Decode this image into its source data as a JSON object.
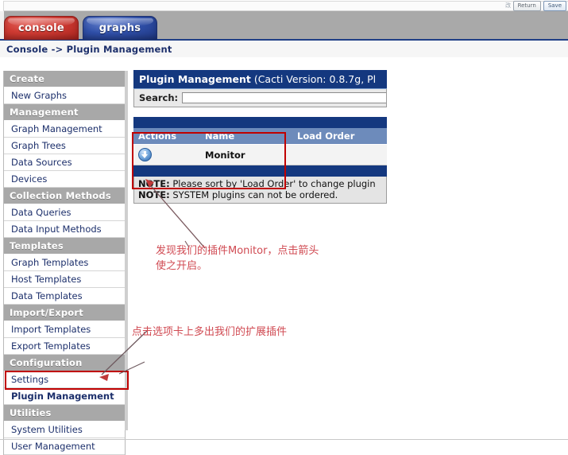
{
  "toolbar": {
    "tiny_text": "改 ",
    "return_label": "Return",
    "save_label": "Save"
  },
  "tabs": [
    {
      "label": "console",
      "active": true,
      "color": "#cf3b33"
    },
    {
      "label": "graphs",
      "active": false,
      "color": "#2f4fa8"
    }
  ],
  "breadcrumb": "Console -> Plugin Management",
  "sidebar": {
    "groups": [
      {
        "header": "Create",
        "items": [
          {
            "label": "New Graphs",
            "selected": false
          }
        ]
      },
      {
        "header": "Management",
        "items": [
          {
            "label": "Graph Management",
            "selected": false
          },
          {
            "label": "Graph Trees",
            "selected": false
          },
          {
            "label": "Data Sources",
            "selected": false
          },
          {
            "label": "Devices",
            "selected": false
          }
        ]
      },
      {
        "header": "Collection Methods",
        "items": [
          {
            "label": "Data Queries",
            "selected": false
          },
          {
            "label": "Data Input Methods",
            "selected": false
          }
        ]
      },
      {
        "header": "Templates",
        "items": [
          {
            "label": "Graph Templates",
            "selected": false
          },
          {
            "label": "Host Templates",
            "selected": false
          },
          {
            "label": "Data Templates",
            "selected": false
          }
        ]
      },
      {
        "header": "Import/Export",
        "items": [
          {
            "label": "Import Templates",
            "selected": false
          },
          {
            "label": "Export Templates",
            "selected": false
          }
        ]
      },
      {
        "header": "Configuration",
        "items": [
          {
            "label": "Settings",
            "selected": false
          },
          {
            "label": "Plugin Management",
            "selected": true
          }
        ]
      },
      {
        "header": "Utilities",
        "items": [
          {
            "label": "System Utilities",
            "selected": false
          },
          {
            "label": "User Management",
            "selected": false
          }
        ]
      }
    ]
  },
  "content": {
    "panel_title_bold": "Plugin Management",
    "panel_title_rest": " (Cacti Version: 0.8.7g, Pl",
    "search": {
      "label": "Search:",
      "value": "",
      "placeholder": ""
    },
    "table": {
      "columns": [
        "Actions",
        "Name",
        "Load Order"
      ],
      "rows": [
        {
          "action_icon": "download-arrow-icon",
          "name": "Monitor",
          "load_order": ""
        }
      ]
    },
    "notes": [
      {
        "prefix": "NOTE:",
        "text": " Please sort by 'Load Order' to change plugin"
      },
      {
        "prefix": "NOTE:",
        "text": " SYSTEM plugins can not be ordered."
      }
    ]
  },
  "annotations": {
    "accent_color": "#c00000",
    "text_color": "#d04a52",
    "note_plugin_line1": "发现我们的插件Monitor，点击箭头",
    "note_plugin_line2": "使之开启。",
    "note_tab": "点击选项卡上多出我们的扩展插件"
  }
}
